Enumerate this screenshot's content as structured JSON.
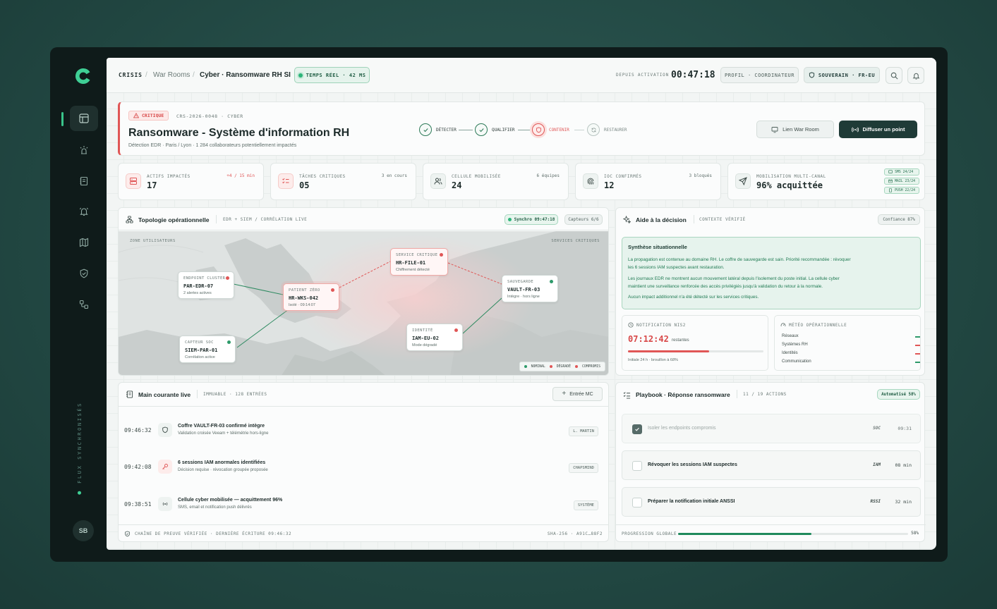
{
  "sidebar": {
    "sync_label": "FLUX SYNCHRONISÉS",
    "avatar": "SB"
  },
  "topbar": {
    "crumb_root": "CRISIS",
    "crumb_sep1": "/",
    "crumb_mid": "War Rooms",
    "crumb_sep2": "/",
    "crumb_current": "Cyber · Ransomware RH SI",
    "realtime": "TEMPS RÉEL · 42 MS",
    "since_label": "DEPUIS ACTIVATION",
    "timer": "00:47:18",
    "profile": "PROFIL · COORDINATEUR",
    "sovereign": "SOUVERAIN · FR-EU"
  },
  "incident": {
    "severity": "CRITIQUE",
    "ref": "CRS-2026-0048 · CYBER",
    "title": "Ransomware - Système d'information RH",
    "subtitle": "Détection EDR · Paris / Lyon · 1 284 collaborateurs potentiellement impactés",
    "steps": [
      "DÉTECTER",
      "QUALIFIER",
      "CONTENIR",
      "RESTAURER"
    ],
    "btn_link": "Lien War Room",
    "btn_broadcast": "Diffuser un point"
  },
  "kpis": [
    {
      "label": "ACTIFS IMPACTÉS",
      "value": "17",
      "side": "+4 / 15 min"
    },
    {
      "label": "TÂCHES CRITIQUES",
      "value": "05",
      "side": "3 en cours"
    },
    {
      "label": "CELLULE MOBILISÉE",
      "value": "24",
      "side": "6 équipes"
    },
    {
      "label": "IOC CONFIRMÉS",
      "value": "12",
      "side": "3 bloqués"
    },
    {
      "label": "MOBILISATION MULTI-CANAL",
      "value": "96% acquittée",
      "channels": [
        "SMS 24/24",
        "MAIL 23/24",
        "PUSH 22/24"
      ]
    }
  ],
  "topology": {
    "title": "Topologie opérationnelle",
    "subtitle": "EDR + SIEM / CORRÉLATION LIVE",
    "sync": "Synchro 09:47:18",
    "sensors": "Capteurs 6/6",
    "zone_left": "ZONE UTILISATEURS",
    "zone_right": "SERVICES CRITIQUES",
    "nodes": [
      {
        "label": "ENDPOINT CLUSTER",
        "name": "PAR-EDR-07",
        "status": "2 alertes actives"
      },
      {
        "label": "PATIENT ZÉRO",
        "name": "HR-WKS-042",
        "status": "Isolé · 09:14:07"
      },
      {
        "label": "SERVICE CRITIQUE",
        "name": "HR-FILE-01",
        "status": "Chiffrement détecté"
      },
      {
        "label": "SAUVEGARDE",
        "name": "VAULT-FR-03",
        "status": "Intègre · hors ligne"
      },
      {
        "label": "IDENTITÉ",
        "name": "IAM-EU-02",
        "status": "Mode dégradé"
      },
      {
        "label": "CAPTEUR SOC",
        "name": "SIEM-PAR-01",
        "status": "Corrélation active"
      }
    ],
    "legend": [
      "NOMINAL",
      "DÉGRADÉ",
      "COMPROMIS"
    ]
  },
  "decision": {
    "title": "Aide à la décision",
    "subtitle": "CONTEXTE VÉRIFIÉ",
    "confidence": "Confiance 87%",
    "synth_title": "Synthèse situationnelle",
    "synth_p1a": "La propagation est contenue au domaine RH. Le coffre de sauvegarde est sain. Priorité recommandée : révoquer",
    "synth_p1b": "les 6 sessions IAM suspectes avant restauration.",
    "synth_p2a": "Les journaux EDR ne montrent aucun mouvement latéral depuis l'isolement du poste initial. La cellule cyber",
    "synth_p2b": "maintient une surveillance renforcée des accès privilégiés jusqu'à validation du retour à la normale.",
    "synth_p3": "Aucun impact additionnel n'a été détecté sur les services critiques.",
    "nis2_label": "NOTIFICATION NIS2",
    "nis2_timer": "07:12:42",
    "nis2_rest": "restantes",
    "nis2_progress": 0.6,
    "nis2_note": "Initiale 24 h · brouillon à 68%",
    "meteo_label": "MÉTÉO OPÉRATIONNELLE",
    "meteo": [
      {
        "name": "Réseaux",
        "color": "#2d9a6a"
      },
      {
        "name": "Systèmes RH",
        "color": "#e05656"
      },
      {
        "name": "Identités",
        "color": "#e05656"
      },
      {
        "name": "Communication",
        "color": "#2d9a6a"
      }
    ]
  },
  "main_courante": {
    "title": "Main courante live",
    "subtitle": "IMMUABLE · 128 ENTRÉES",
    "add_btn": "Entrée MC",
    "entries": [
      {
        "time": "09:46:32",
        "title": "Coffre VAULT-FR-03 confirmé intègre",
        "sub": "Validation croisée Veeam + télémétrie hors-ligne",
        "tag": "L. MARTIN"
      },
      {
        "time": "09:42:08",
        "title": "6 sessions IAM anormales identifiées",
        "sub": "Décision requise · révocation groupée proposée",
        "tag": "CHAPSMIND"
      },
      {
        "time": "09:38:51",
        "title": "Cellule cyber mobilisée — acquittement 96%",
        "sub": "SMS, email et notification push délivrés",
        "tag": "SYSTÈME"
      }
    ],
    "footer_left": "CHAÎNE DE PREUVE VÉRIFIÉE · DERNIÈRE ÉCRITURE 09:46:32",
    "footer_right": "SHA-256 · A91C…88F2"
  },
  "playbook": {
    "title": "Playbook · Réponse ransomware",
    "subtitle": "11 / 19 ACTIONS",
    "auto": "Automatisé 58%",
    "items": [
      {
        "label": "Isoler les endpoints compromis",
        "tag": "SOC",
        "time": "09:31",
        "done": true
      },
      {
        "label": "Révoquer les sessions IAM suspectes",
        "tag": "IAM",
        "time": "08 min",
        "done": false
      },
      {
        "label": "Préparer la notification initiale ANSSI",
        "tag": "RSSI",
        "time": "32 min",
        "done": false
      }
    ],
    "progress_label": "PROGRESSION GLOBALE",
    "progress_value": "58%",
    "progress": 0.58
  },
  "colors": {
    "accent": "#1f8a5c",
    "critical": "#e05656",
    "dark": "#1f3b37"
  }
}
